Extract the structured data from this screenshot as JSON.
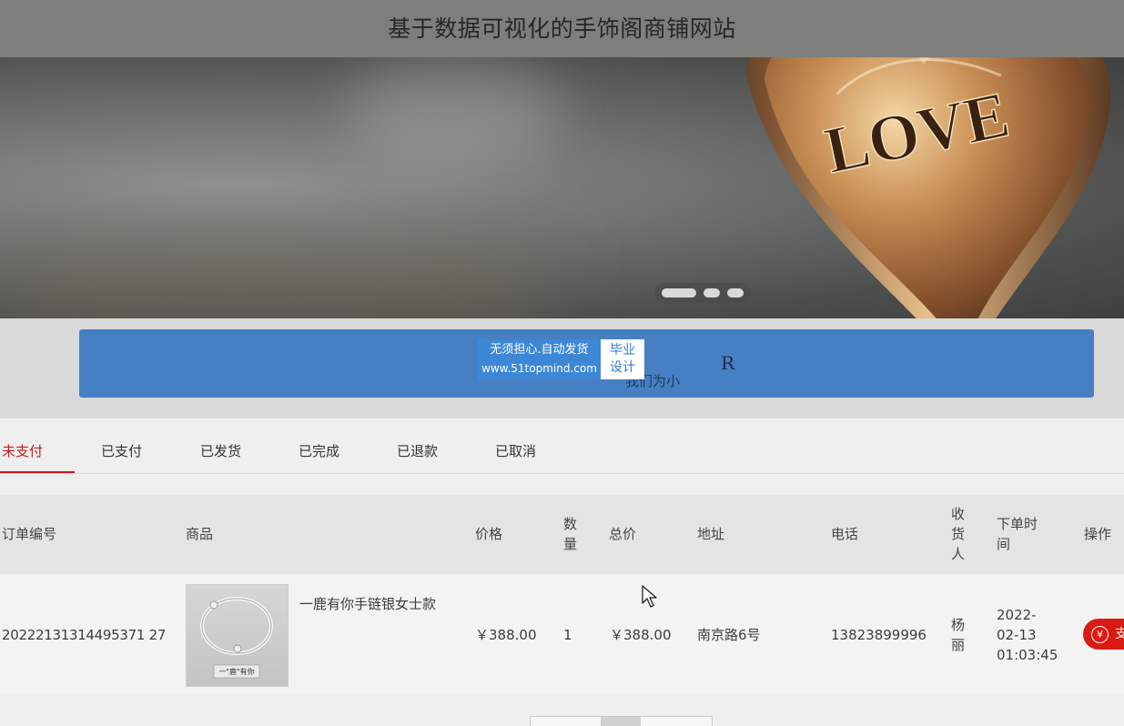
{
  "header": {
    "title": "基于数据可视化的手饰阁商铺网站"
  },
  "banner": {
    "engraving": "LOVE"
  },
  "notice": {
    "visible_letter": "R",
    "partial_text": "我们为小"
  },
  "watermark": {
    "line1": "无须担心.自动发货",
    "line2": "www.51topmind.com",
    "badge_line1": "毕业",
    "badge_line2": "设计"
  },
  "tabs": [
    "未支付",
    "已支付",
    "已发货",
    "已完成",
    "已退款",
    "已取消"
  ],
  "active_tab": "未支付",
  "table": {
    "headers": {
      "order_no": "订单编号",
      "product": "商品",
      "price": "价格",
      "qty_1": "数",
      "qty_2": "量",
      "total": "总价",
      "address": "地址",
      "phone": "电话",
      "receiver_1": "收",
      "receiver_2": "货",
      "receiver_3": "人",
      "time_1": "下单时",
      "time_2": "间",
      "action": "操作"
    },
    "rows": [
      {
        "order_no": "20222131314495371 27",
        "product_name": "一鹿有你手链银女士款",
        "thumb_caption": "一\"鹿\"有你",
        "price": "￥388.00",
        "qty": "1",
        "total": "￥388.00",
        "address": "南京路6号",
        "phone": "13823899996",
        "receiver_1": "杨",
        "receiver_2": "丽",
        "date": "2022-",
        "date2": "02-13",
        "time": "01:03:45",
        "action_icon": "¥",
        "action_label": "支"
      }
    ]
  },
  "colors": {
    "accent": "#c9191e",
    "notice_blue": "#4680c2",
    "pay_button": "#d91b13",
    "header_gray": "#7e7f7d"
  }
}
